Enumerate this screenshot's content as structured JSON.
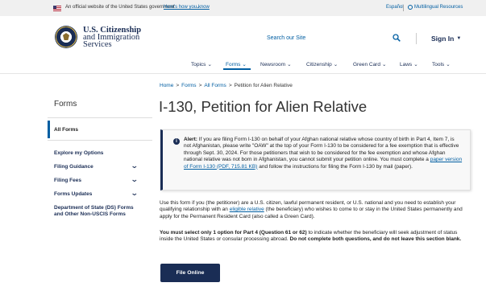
{
  "gov_banner": {
    "text": "An official website of the United States government",
    "link": "Here's how you know",
    "espanol": "Español",
    "multilingual": "Multilingual Resources"
  },
  "header": {
    "brand": [
      "U.S. Citizenship",
      "and Immigration",
      "Services"
    ],
    "search_label": "Search our Site",
    "signin": "Sign In"
  },
  "nav": {
    "items": [
      "Topics",
      "Forms",
      "Newsroom",
      "Citizenship",
      "Green Card",
      "Laws",
      "Tools"
    ],
    "active": "Forms"
  },
  "breadcrumb": [
    "Home",
    "Forms",
    "All Forms",
    "Petition for Alien Relative"
  ],
  "sidebar": {
    "title": "Forms",
    "active": "All Forms",
    "items": [
      {
        "label": "Explore my Options",
        "expandable": false
      },
      {
        "label": "Filing Guidance",
        "expandable": true
      },
      {
        "label": "Filing Fees",
        "expandable": true
      },
      {
        "label": "Forms Updates",
        "expandable": true
      },
      {
        "label": "Department of State (DS) Forms and Other Non-USCIS Forms",
        "expandable": false
      }
    ]
  },
  "main": {
    "title": "I-130, Petition for Alien Relative",
    "alert": {
      "label": "Alert:",
      "text": " If you are filing Form I-130 on behalf of your Afghan national relative whose country of birth in Part 4, Item 7, is not Afghanistan, please write \"OAW\" at the top of your Form I-130 to be considered for a fee exemption that is effective through Sept. 30, 2024. For those petitioners that wish to be considered for the fee exemption and whose Afghan national relative was not born in Afghanistan, you cannot submit your petition online. You must complete a ",
      "link": "paper version of Form I-130 (PDF, 715.81 KB)",
      "text_after": " and follow the instructions for filing the Form I-130 by mail (paper)."
    },
    "intro": {
      "before": "Use this form if you (the petitioner) are a U.S. citizen, lawful permanent resident, or U.S. national and you need to establish your qualifying relationship with an ",
      "link": "eligible relative",
      "after": " (the beneficiary) who wishes to come to or stay in the United States permanently and apply for the Permanent Resident Card (also called a Green Card)."
    },
    "notice": {
      "bold1": "You must select only 1 option for Part 4 (Question 61 or 62)",
      "normal": " to indicate whether the beneficiary will seek adjustment of status inside the United States or consular processing abroad. ",
      "bold2": "Do not complete both questions, and do not leave this section blank."
    },
    "button": "File Online"
  },
  "colors": {
    "navy": "#1a2d55",
    "link_blue": "#005ea2",
    "banner_bg": "#f0f0f0"
  }
}
